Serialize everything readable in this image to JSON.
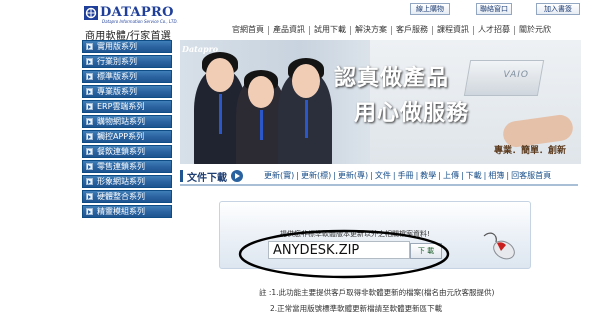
{
  "logo": {
    "brand": "DATAPRO",
    "sub": "Datapro Information Service Co., LTD.",
    "slogan": "商用軟體/行家首選"
  },
  "top_buttons": {
    "login": "線上購物",
    "cart": "聯絡窗口",
    "favorite": "加入書簽"
  },
  "nav": [
    "官網首頁",
    "產品資訊",
    "試用下載",
    "解決方案",
    "客戶服務",
    "課程資訊",
    "人才招募",
    "關於元欣"
  ],
  "sidebar": [
    "實用版系列",
    "行業別系列",
    "標準版系列",
    "專業版系列",
    "ERP雲端系列",
    "購物網站系列",
    "觸控APP系列",
    "餐飲連鎖系列",
    "零售連鎖系列",
    "形象網站系列",
    "硬體整合系列",
    "精靈模組系列"
  ],
  "banner": {
    "corner": "Datapro",
    "laptop_text": "VAIO",
    "headline1": "認真做產品",
    "headline2": "用心做服務",
    "tagline": "專業．簡單．創新"
  },
  "section": {
    "title": "文件下載",
    "subnav": [
      "更新(實)",
      "更新(標)",
      "更新(專)",
      "文件",
      "手冊",
      "教學",
      "上傳",
      "下載",
      "相簿",
      "回客服首頁"
    ]
  },
  "download": {
    "label": "提供您非標準軟體版本更新以外之相關檔案資料!",
    "input_value": "ANYDESK.ZIP",
    "button": "下 載"
  },
  "notes": [
    "註 :1.此功能主要提供客戶取得非軟體更新的檔案(檔名由元欣客服提供)",
    "2.正常當用版號標準軟體更新檔請至軟體更新區下載"
  ],
  "colors": {
    "sidebar": "#2a62a0",
    "brand": "#1f3f9a",
    "link": "#1a4f8a"
  }
}
